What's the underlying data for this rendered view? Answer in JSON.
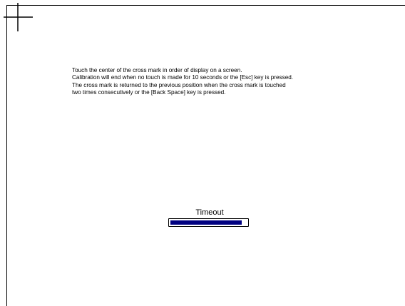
{
  "colors": {
    "background": "#ffffff",
    "text": "#000000",
    "progress_fill": "#000080"
  },
  "cross_mark": {
    "icon": "calibration-crosshair-icon"
  },
  "instructions": {
    "lines": [
      "Touch the center of the cross mark in order of display on a screen.",
      "Calibration will end when no touch is made for 10 seconds or the [Esc] key is pressed.",
      "The cross mark is returned to the previous position when the cross mark is touched",
      "two times consecutively or the [Back Space] key is pressed."
    ]
  },
  "timeout": {
    "label": "Timeout",
    "progress": 0.93
  }
}
